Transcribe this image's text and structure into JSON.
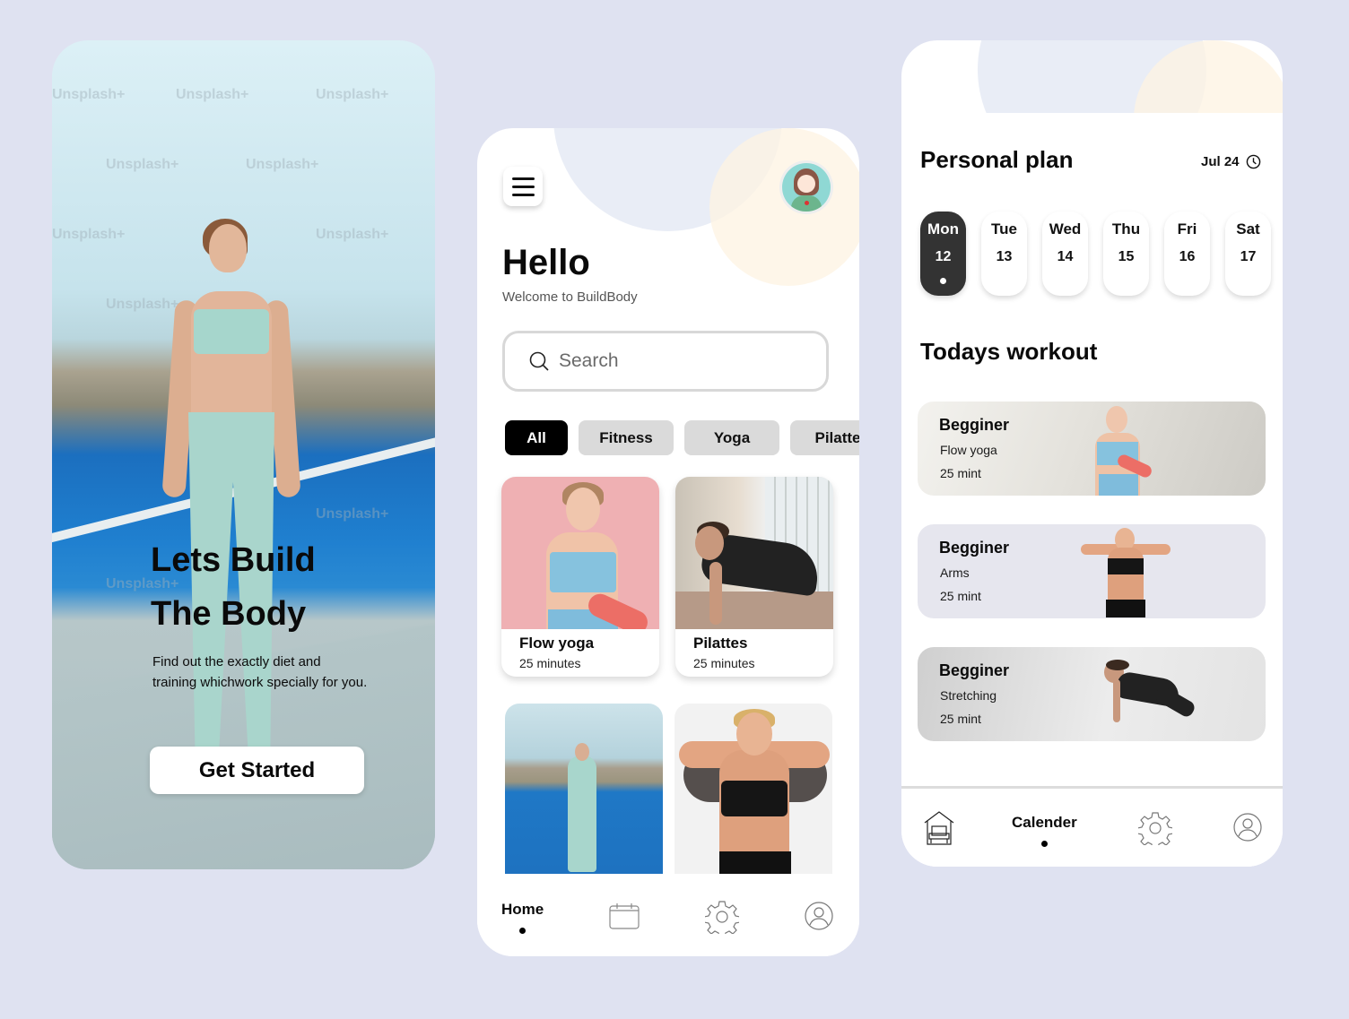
{
  "colors": {
    "background": "#dfe2f1",
    "accent_dark": "#000000",
    "chip_inactive": "#dadada",
    "day_active": "#333333",
    "blob_blue": "#e9edf6",
    "blob_cream": "#fef3e2"
  },
  "onboarding": {
    "headline_line1": "Lets Build",
    "headline_line2": "The Body",
    "description": "Find out the exactly diet and training whichwork specially for you.",
    "cta_label": "Get Started",
    "watermark": "Unsplash+"
  },
  "home": {
    "menu_icon": "hamburger-menu-icon",
    "avatar_icon": "user-avatar",
    "greeting": "Hello",
    "welcome": "Welcome to BuildBody",
    "search": {
      "placeholder": "Search",
      "value": ""
    },
    "chips": [
      {
        "label": "All",
        "active": true
      },
      {
        "label": "Fitness",
        "active": false
      },
      {
        "label": "Yoga",
        "active": false
      },
      {
        "label": "Pilatte",
        "active": false
      }
    ],
    "cards": [
      {
        "title": "Flow yoga",
        "subtitle": "25 minutes"
      },
      {
        "title": "Pilattes",
        "subtitle": "25 minutes"
      },
      {
        "title": "",
        "subtitle": ""
      },
      {
        "title": "",
        "subtitle": ""
      }
    ],
    "nav": {
      "home_label": "Home",
      "calendar_icon": "calendar-icon",
      "settings_icon": "gear-icon",
      "profile_icon": "user-circle-icon"
    }
  },
  "plan": {
    "title": "Personal plan",
    "date": "Jul 24",
    "days": [
      {
        "name": "Mon",
        "num": "12",
        "active": true
      },
      {
        "name": "Tue",
        "num": "13",
        "active": false
      },
      {
        "name": "Wed",
        "num": "14",
        "active": false
      },
      {
        "name": "Thu",
        "num": "15",
        "active": false
      },
      {
        "name": "Fri",
        "num": "16",
        "active": false
      },
      {
        "name": "Sat",
        "num": "17",
        "active": false
      }
    ],
    "today_title": "Todays workout",
    "workouts": [
      {
        "level": "Begginer",
        "name": "Flow yoga",
        "duration": "25 mint"
      },
      {
        "level": "Begginer",
        "name": "Arms",
        "duration": "25 mint"
      },
      {
        "level": "Begginer",
        "name": "Stretching",
        "duration": "25 mint"
      }
    ],
    "nav": {
      "home_icon": "house-icon",
      "calendar_label": "Calender",
      "settings_icon": "gear-icon",
      "profile_icon": "user-circle-icon"
    }
  }
}
